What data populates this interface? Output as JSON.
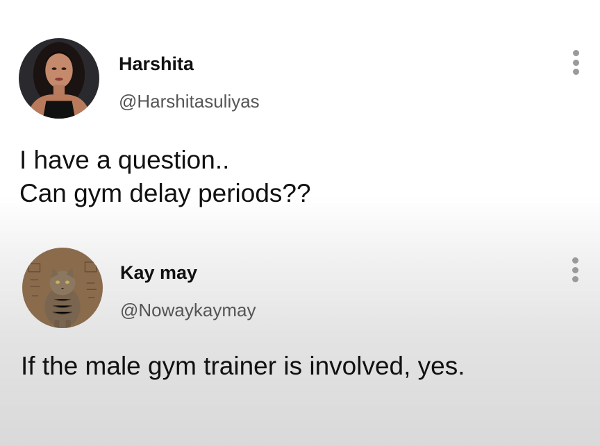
{
  "posts": [
    {
      "author": "Harshita",
      "handle": "@Harshitasuliyas",
      "text_lines": [
        "I have a question..",
        "Can gym delay periods??"
      ]
    },
    {
      "author": "Kay may",
      "handle": "@Nowaykaymay",
      "text_lines": [
        "If the male gym trainer is involved, yes."
      ]
    }
  ],
  "icons": {
    "menu": "more-vertical-icon",
    "avatar_1": "woman-portrait",
    "avatar_2": "cat-portrait"
  },
  "colors": {
    "name": "#111111",
    "handle": "#555555",
    "menu_dots": "#9a9a9a"
  }
}
